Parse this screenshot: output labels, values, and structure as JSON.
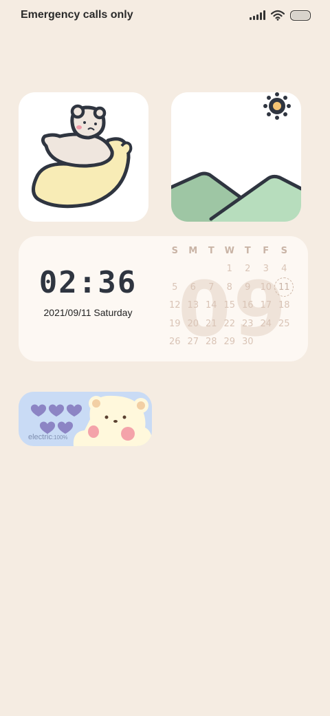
{
  "status_bar": {
    "carrier": "Emergency calls only",
    "icons": [
      "signal-icon",
      "wifi-icon",
      "battery-icon"
    ]
  },
  "widgets": {
    "bear_moon": {
      "icon": "bear-on-moon-illustration"
    },
    "mountain": {
      "icon": "sun-mountains-illustration"
    },
    "clock": {
      "time": "02:36",
      "date": "2021/09/11 Saturday"
    },
    "calendar": {
      "month_watermark": "09",
      "weekdays": [
        "S",
        "M",
        "T",
        "W",
        "T",
        "F",
        "S"
      ],
      "weeks": [
        [
          "",
          "",
          "",
          "1",
          "2",
          "3",
          "4"
        ],
        [
          "5",
          "6",
          "7",
          "8",
          "9",
          "10",
          "11"
        ],
        [
          "12",
          "13",
          "14",
          "15",
          "16",
          "17",
          "18"
        ],
        [
          "19",
          "20",
          "21",
          "22",
          "23",
          "24",
          "25"
        ],
        [
          "26",
          "27",
          "28",
          "29",
          "30",
          "",
          ""
        ]
      ],
      "today": "11"
    },
    "battery": {
      "label": "electric",
      "percent": ":100%",
      "level": 1.0,
      "hearts": 5
    }
  },
  "colors": {
    "background": "#f5ece2",
    "widget_card": "#fdf8f3",
    "clock_text": "#2f3540",
    "calendar_text": "#d9c4b6",
    "battery_card": "#c9dbf5",
    "heart": "#8c84c4",
    "mountain_green": "#9ec6a4"
  }
}
